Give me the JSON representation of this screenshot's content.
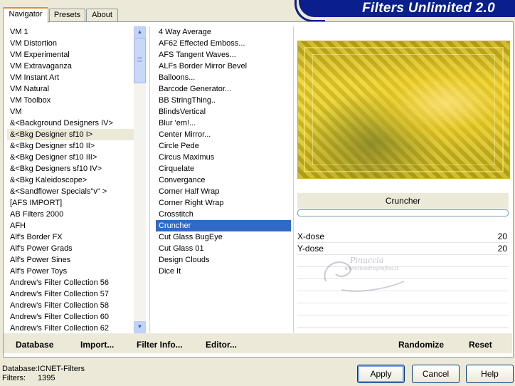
{
  "app": {
    "title": "Filters Unlimited 2.0"
  },
  "tabs": [
    {
      "label": "Navigator",
      "active": true
    },
    {
      "label": "Presets",
      "active": false
    },
    {
      "label": "About",
      "active": false
    }
  ],
  "categories": {
    "items": [
      "VM 1",
      "VM Distortion",
      "VM Experimental",
      "VM Extravaganza",
      "VM Instant Art",
      "VM Natural",
      "VM Toolbox",
      "VM",
      "&<Background Designers IV>",
      "&<Bkg Designer sf10 I>",
      "&<Bkg Designer sf10 II>",
      "&<Bkg Designer sf10 III>",
      "&<Bkg Designers sf10 IV>",
      "&<Bkg Kaleidoscope>",
      "&<Sandflower Specials\"v\" >",
      "[AFS IMPORT]",
      "AB Filters 2000",
      "AFH",
      "Alf's Border FX",
      "Alf's Power Grads",
      "Alf's Power Sines",
      "Alf's Power Toys",
      "Andrew's Filter Collection 56",
      "Andrew's Filter Collection 57",
      "Andrew's Filter Collection 58",
      "Andrew's Filter Collection 60",
      "Andrew's Filter Collection 62"
    ],
    "selected_index": 9
  },
  "filters": {
    "items": [
      "4 Way Average",
      "AF62 Effected Emboss...",
      "AFS Tangent Waves...",
      "ALFs Border Mirror Bevel",
      "Balloons...",
      "Barcode Generator...",
      "BB StringThing..",
      "BlindsVertical",
      "Blur 'em!...",
      "Center Mirror...",
      "Circle Pede",
      "Circus Maximus",
      "Cirquelate",
      "Convergance",
      "Corner Half Wrap",
      "Corner Right Wrap",
      "Crosstitch",
      "Cruncher",
      "Cut Glass  BugEye",
      "Cut Glass 01",
      "Design Clouds",
      "Dice It"
    ],
    "selected_index": 17
  },
  "toolbar": {
    "database": "Database",
    "import": "Import...",
    "filter_info": "Filter Info...",
    "editor": "Editor...",
    "randomize": "Randomize",
    "reset": "Reset"
  },
  "preview": {
    "filter_name": "Cruncher",
    "progress": 0
  },
  "params": [
    {
      "name": "X-dose",
      "value": "20"
    },
    {
      "name": "Y-dose",
      "value": "20"
    }
  ],
  "watermark": {
    "line1": "Pinuccia",
    "line2": "www.maidragrafica.it"
  },
  "status": {
    "database_label": "Database:",
    "database_value": "ICNET-Filters",
    "filters_label": "Filters:",
    "filters_value": "1395"
  },
  "actions": {
    "apply": "Apply",
    "cancel": "Cancel",
    "help": "Help"
  }
}
